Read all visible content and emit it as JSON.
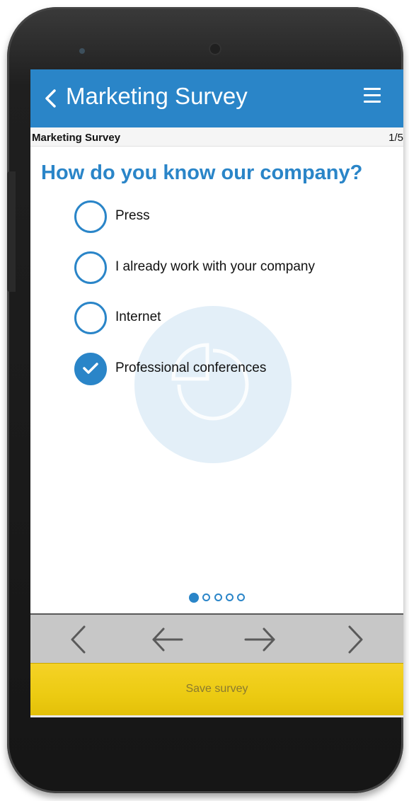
{
  "appbar": {
    "title": "Marketing Survey",
    "back_icon": "chevron-left-icon",
    "menu_icon": "hamburger-menu-icon",
    "color": "#2a85c8"
  },
  "subheader": {
    "title": "Marketing Survey",
    "page": "1/5"
  },
  "question": {
    "text": "How do you know our company?",
    "color": "#2a85c8"
  },
  "options": [
    {
      "label": "Press",
      "selected": false
    },
    {
      "label": "I already work with your company",
      "selected": false
    },
    {
      "label": "Internet",
      "selected": false
    },
    {
      "label": "Professional conferences",
      "selected": true
    }
  ],
  "pagination": {
    "total": 5,
    "current": 1
  },
  "navigation": {
    "first_icon": "chevron-left-icon",
    "prev_icon": "arrow-left-icon",
    "next_icon": "arrow-right-icon",
    "last_icon": "chevron-right-icon"
  },
  "save": {
    "label": "Save survey",
    "color": "#eccb12"
  },
  "watermark_icon": "pie-chart-icon"
}
